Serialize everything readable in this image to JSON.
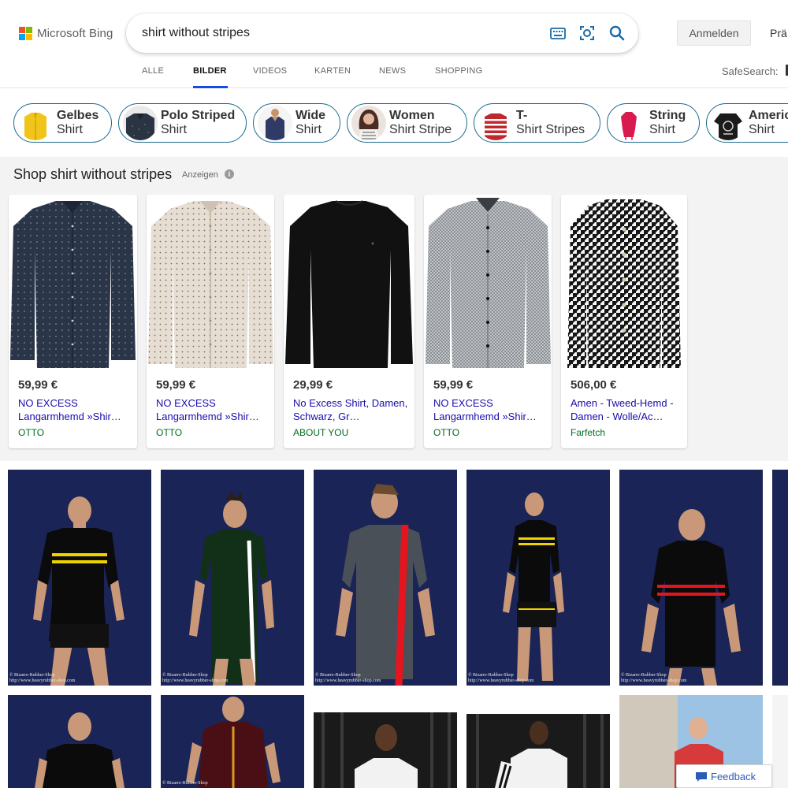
{
  "brand": {
    "name": "Microsoft Bing",
    "colors": [
      "#f25022",
      "#7fba00",
      "#00a4ef",
      "#ffb900"
    ]
  },
  "search": {
    "query": "shirt without stripes",
    "icons": [
      "keyboard-icon",
      "visual-search-icon",
      "search-icon"
    ]
  },
  "header": {
    "signin_label": "Anmelden",
    "preferences_label": "Prä",
    "safesearch_label": "SafeSearch:"
  },
  "tabs": [
    {
      "label": "ALLE",
      "active": false
    },
    {
      "label": "BILDER",
      "active": true
    },
    {
      "label": "VIDEOS",
      "active": false
    },
    {
      "label": "KARTEN",
      "active": false
    },
    {
      "label": "NEWS",
      "active": false
    },
    {
      "label": "SHOPPING",
      "active": false
    }
  ],
  "related": [
    {
      "line1": "Gelbes",
      "line2": "Shirt"
    },
    {
      "line1": "Polo Striped",
      "line2": "Shirt"
    },
    {
      "line1": "Wide",
      "line2": "Shirt"
    },
    {
      "line1": "Women",
      "line2": "Shirt Stripe"
    },
    {
      "line1": "T-",
      "line2": "Shirt Stripes"
    },
    {
      "line1": "String",
      "line2": "Shirt"
    },
    {
      "line1": "Americ",
      "line2": "Shirt"
    }
  ],
  "shopping": {
    "title": "Shop shirt without stripes",
    "ads_label": "Anzeigen",
    "products": [
      {
        "price": "59,99 €",
        "title": "NO EXCESS Langarmhemd »Shir…",
        "merchant": "OTTO"
      },
      {
        "price": "59,99 €",
        "title": "NO EXCESS Langarmhemd »Shir…",
        "merchant": "OTTO"
      },
      {
        "price": "29,99 €",
        "title": "No Excess Shirt, Damen, Schwarz, Gr…",
        "merchant": "ABOUT YOU"
      },
      {
        "price": "59,99 €",
        "title": "NO EXCESS Langarmhemd »Shir…",
        "merchant": "OTTO"
      },
      {
        "price": "506,00 €",
        "title": "Amen - Tweed-Hemd - Damen - Wolle/Ac…",
        "merchant": "Farfetch"
      }
    ]
  },
  "images": {
    "watermark_line1": "© Bizarre-Rubber-Shop",
    "watermark_line2": "http://www.heavyrubber-shop.com"
  },
  "feedback_label": "Feedback"
}
